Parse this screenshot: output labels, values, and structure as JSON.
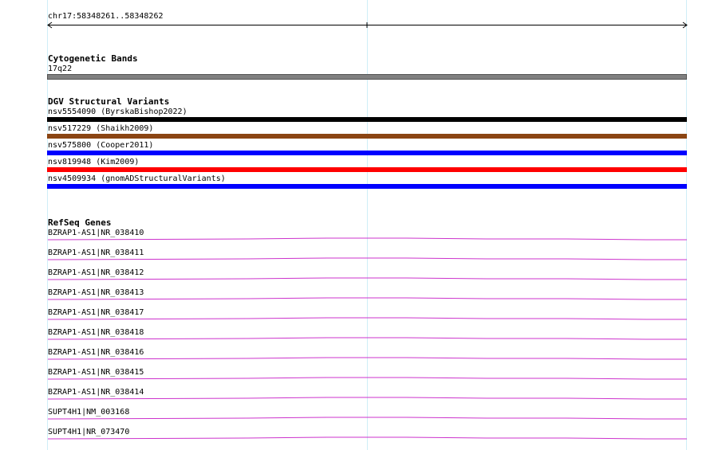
{
  "ruler": {
    "location": "chr17:58348261..58348262"
  },
  "cytogenetic": {
    "title": "Cytogenetic Bands",
    "band": "17q22",
    "band_color": "#808080"
  },
  "dgv": {
    "title": "DGV Structural Variants",
    "variants": [
      {
        "label": "nsv5554090 (ByrskaBishop2022)",
        "color": "#000000"
      },
      {
        "label": "nsv517229 (Shaikh2009)",
        "color": "#8b4513"
      },
      {
        "label": "nsv575800 (Cooper2011)",
        "color": "#0000ff"
      },
      {
        "label": "nsv819948 (Kim2009)",
        "color": "#ff0000"
      },
      {
        "label": "nsv4509934 (gnomADStructuralVariants)",
        "color": "#0000ff"
      }
    ]
  },
  "refseq": {
    "title": "RefSeq Genes",
    "gene_color": "#cc33cc",
    "genes": [
      {
        "label": "BZRAP1-AS1|NR_038410"
      },
      {
        "label": "BZRAP1-AS1|NR_038411"
      },
      {
        "label": "BZRAP1-AS1|NR_038412"
      },
      {
        "label": "BZRAP1-AS1|NR_038413"
      },
      {
        "label": "BZRAP1-AS1|NR_038417"
      },
      {
        "label": "BZRAP1-AS1|NR_038418"
      },
      {
        "label": "BZRAP1-AS1|NR_038416"
      },
      {
        "label": "BZRAP1-AS1|NR_038415"
      },
      {
        "label": "BZRAP1-AS1|NR_038414"
      },
      {
        "label": "SUPT4H1|NM_003168"
      },
      {
        "label": "SUPT4H1|NR_073470"
      }
    ]
  }
}
